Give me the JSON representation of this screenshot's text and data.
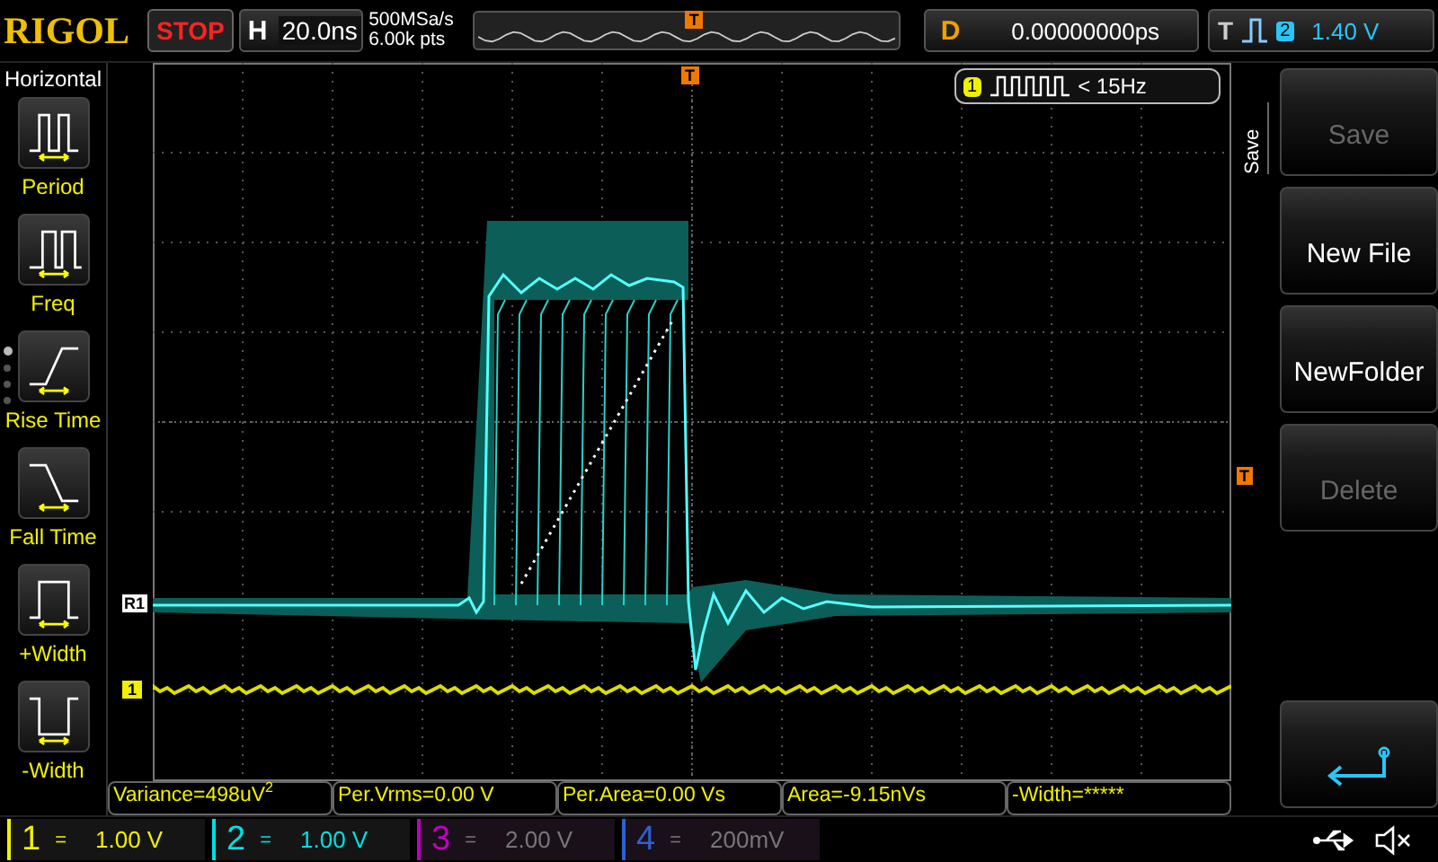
{
  "top_bar": {
    "brand": "RIGOL",
    "run_state": "STOP",
    "running": false,
    "timebase_label": "H",
    "timebase": "20.0ns",
    "sample_rate": "500MSa/s",
    "memory_depth": "6.00k pts",
    "trigger_marker": "T",
    "delay_label": "D",
    "delay": "0.00000000ps",
    "trigger_label": "T",
    "trigger_source": "2",
    "trigger_level": "1.40 V"
  },
  "left_menu": {
    "title": "Horizontal",
    "pages": [
      {
        "selected": true
      },
      {
        "selected": false
      },
      {
        "selected": false
      },
      {
        "selected": false
      }
    ],
    "items": [
      {
        "kind": "period",
        "label": "Period"
      },
      {
        "kind": "freq",
        "label": "Freq"
      },
      {
        "kind": "rise",
        "label": "Rise Time"
      },
      {
        "kind": "fall",
        "label": "Fall Time"
      },
      {
        "kind": "pwidth",
        "label": "+Width"
      },
      {
        "kind": "nwidth",
        "label": "-Width"
      }
    ]
  },
  "screen": {
    "trigger_position_marker": "T",
    "trigger_level_marker": "T",
    "ref_marker": "R1",
    "channel_marker": "1",
    "counter": {
      "channel": "1",
      "reading": "< 15Hz"
    }
  },
  "right_menu": {
    "title": "Save",
    "buttons": [
      {
        "kind": "text",
        "label": "Save",
        "disabled": true
      },
      {
        "kind": "text",
        "label": "New File",
        "disabled": false
      },
      {
        "kind": "text",
        "label": "NewFolder",
        "disabled": false
      },
      {
        "kind": "text",
        "label": "Delete",
        "disabled": true
      },
      {
        "kind": "back"
      }
    ]
  },
  "measurements": [
    {
      "text": "Variance=498uV",
      "sup": "2"
    },
    {
      "text": "Per.Vrms=0.00 V"
    },
    {
      "text": "Per.Area=0.00 Vs"
    },
    {
      "text": "Area=-9.15nVs"
    },
    {
      "text": "-Width=*****"
    }
  ],
  "channels": [
    {
      "number": "1",
      "coupling": "=",
      "scale": "1.00 V",
      "enabled": true,
      "color": "#f0f000"
    },
    {
      "number": "2",
      "coupling": "=",
      "scale": "1.00 V",
      "enabled": true,
      "color": "#00e0e0"
    },
    {
      "number": "3",
      "coupling": "=",
      "scale": "2.00 V",
      "enabled": false,
      "color": "#c000c0"
    },
    {
      "number": "4",
      "coupling": "=",
      "scale": "200mV",
      "enabled": false,
      "color": "#3060d0"
    }
  ]
}
